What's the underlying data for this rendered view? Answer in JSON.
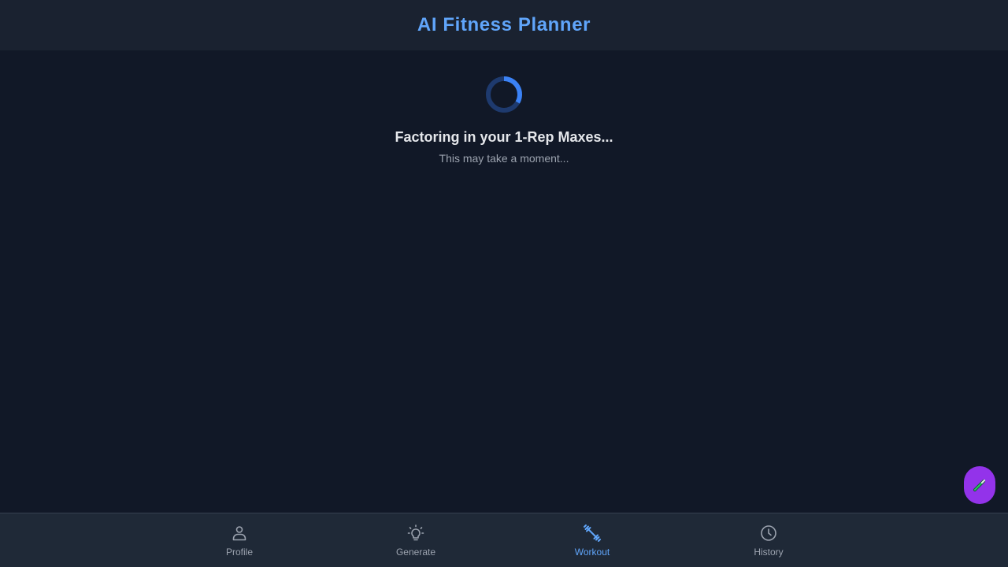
{
  "header": {
    "title": "AI Fitness Planner"
  },
  "loading": {
    "title": "Factoring in your 1-Rep Maxes...",
    "subtitle": "This may take a moment..."
  },
  "fab": {
    "icon": "pencil-icon",
    "color": "#9333ea"
  },
  "nav": {
    "items": [
      {
        "label": "Profile",
        "icon": "user-icon",
        "active": false
      },
      {
        "label": "Generate",
        "icon": "lightbulb-icon",
        "active": false
      },
      {
        "label": "Workout",
        "icon": "dumbbell-icon",
        "active": true
      },
      {
        "label": "History",
        "icon": "clock-icon",
        "active": false
      }
    ]
  },
  "colors": {
    "accent": "#60a5fa",
    "background": "#111827",
    "nav_background": "#1f2937",
    "fab": "#9333ea"
  }
}
